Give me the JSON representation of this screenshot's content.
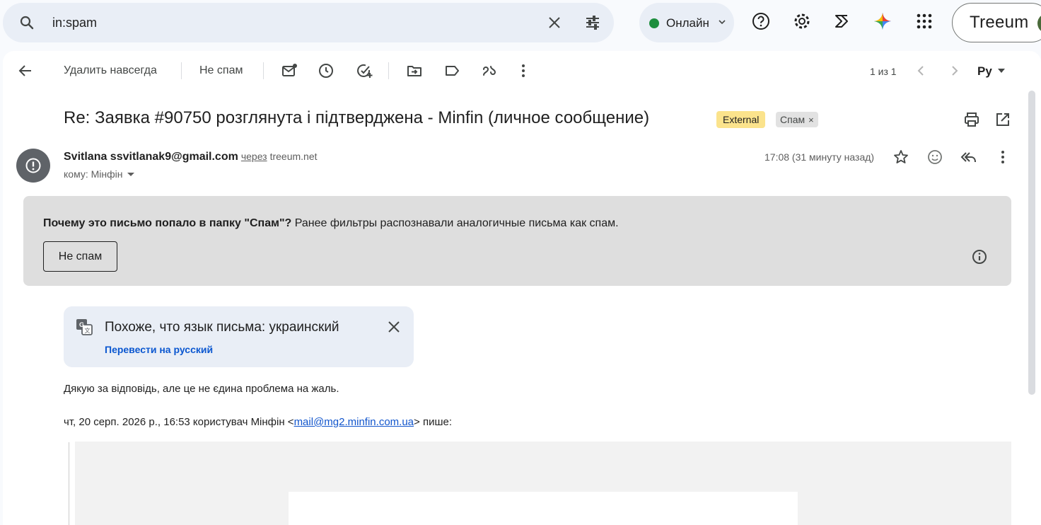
{
  "search": {
    "query": "in:spam",
    "icons": [
      "search-icon",
      "clear-icon",
      "tune-icon"
    ]
  },
  "status": {
    "label": "Онлайн",
    "color": "#1e8e3e"
  },
  "top_icons": [
    "help-icon",
    "settings-icon",
    "extension-icon",
    "gemini-icon",
    "apps-icon"
  ],
  "account": {
    "brand": "Treeum"
  },
  "toolbar": {
    "delete_forever": "Удалить навсегда",
    "not_spam": "Не спам",
    "pager": "1 из 1",
    "language_selector": "Ру"
  },
  "message": {
    "subject": "Re: Заявка #90750 розглянута і підтверджена - Minfin (личное сообщение)",
    "labels": {
      "external": "External",
      "spam": "Спам"
    },
    "sender_name": "Svitlana ssvitlanak9@gmail.com",
    "via": "через",
    "via_domain": "treeum.net",
    "recipient": "кому: Мінфін",
    "time": "17:08 (31 минуту назад)"
  },
  "spam_warning": {
    "question": "Почему это письмо попало в папку \"Спам\"?",
    "explanation": " Ранее фильтры распознавали аналогичные письма как спам.",
    "button": "Не спам"
  },
  "translate": {
    "title": "Похоже, что язык письма: украинский",
    "link": "Перевести на русский"
  },
  "body": {
    "line1": "Дякую за відповідь, але це не єдина проблема на жаль.",
    "quote_prefix": "чт, 20 серп. 2026 р., 16:53 користувач Мінфін <",
    "quote_email": "mail@mg2.minfin.com.ua",
    "quote_suffix": "> пише:"
  },
  "colors": {
    "accent": "#0b57d0",
    "external_badge": "#fbe38c",
    "warning_bg": "#dedede"
  }
}
